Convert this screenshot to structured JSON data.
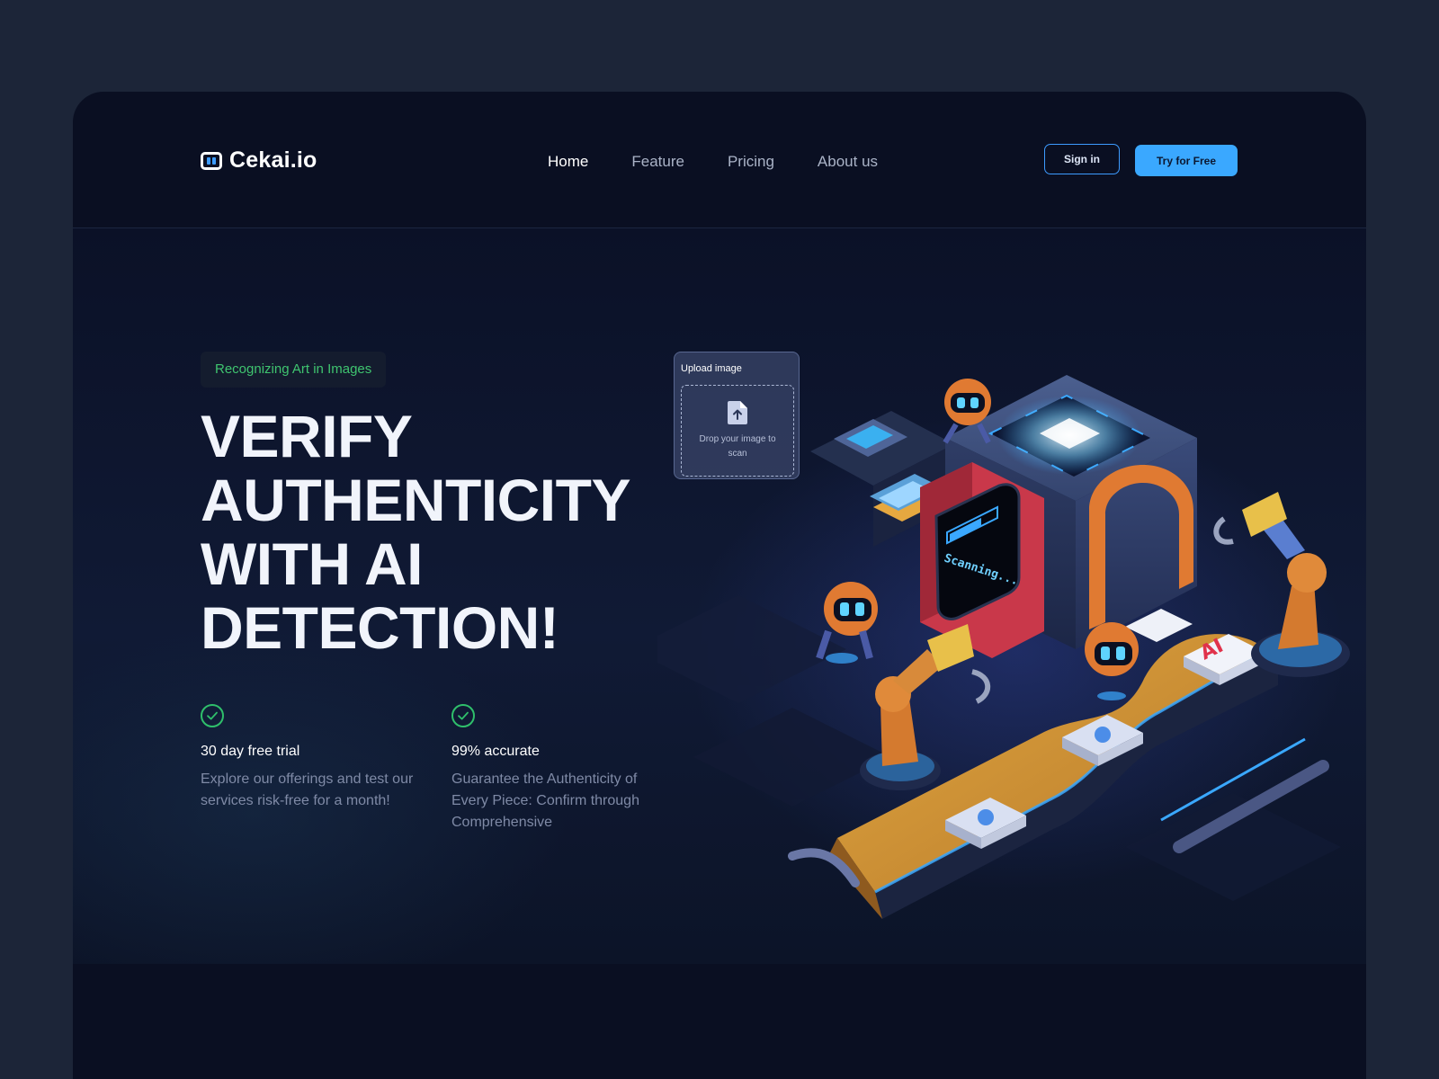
{
  "header": {
    "logo_text": "Cekai.io",
    "nav": [
      "Home",
      "Feature",
      "Pricing",
      "About us"
    ],
    "active_nav": "Home",
    "sign_in_label": "Sign in",
    "try_label": "Try for Free"
  },
  "hero": {
    "tag": "Recognizing Art in Images",
    "headline": [
      "VERIFY",
      "AUTHENTICITY",
      "WITH AI",
      "DETECTION!"
    ],
    "features": [
      {
        "icon": "check-circle-icon",
        "title": "30 day free trial",
        "description": "Explore our offerings and test our services risk-free for a month!"
      },
      {
        "icon": "check-circle-icon",
        "title": "99% accurate",
        "description": "Guarantee the Authenticity of Every Piece: Confirm through Comprehensive"
      }
    ]
  },
  "upload_card": {
    "title": "Upload image",
    "drop_text": "Drop your image to scan"
  },
  "illustration": {
    "screen_text": "Scanning...",
    "badge_text": "AI"
  },
  "colors": {
    "page_bg": "#1c2538",
    "frame_bg": "#0a0f22",
    "accent_blue": "#3aa8ff",
    "accent_green": "#3fc46f"
  }
}
